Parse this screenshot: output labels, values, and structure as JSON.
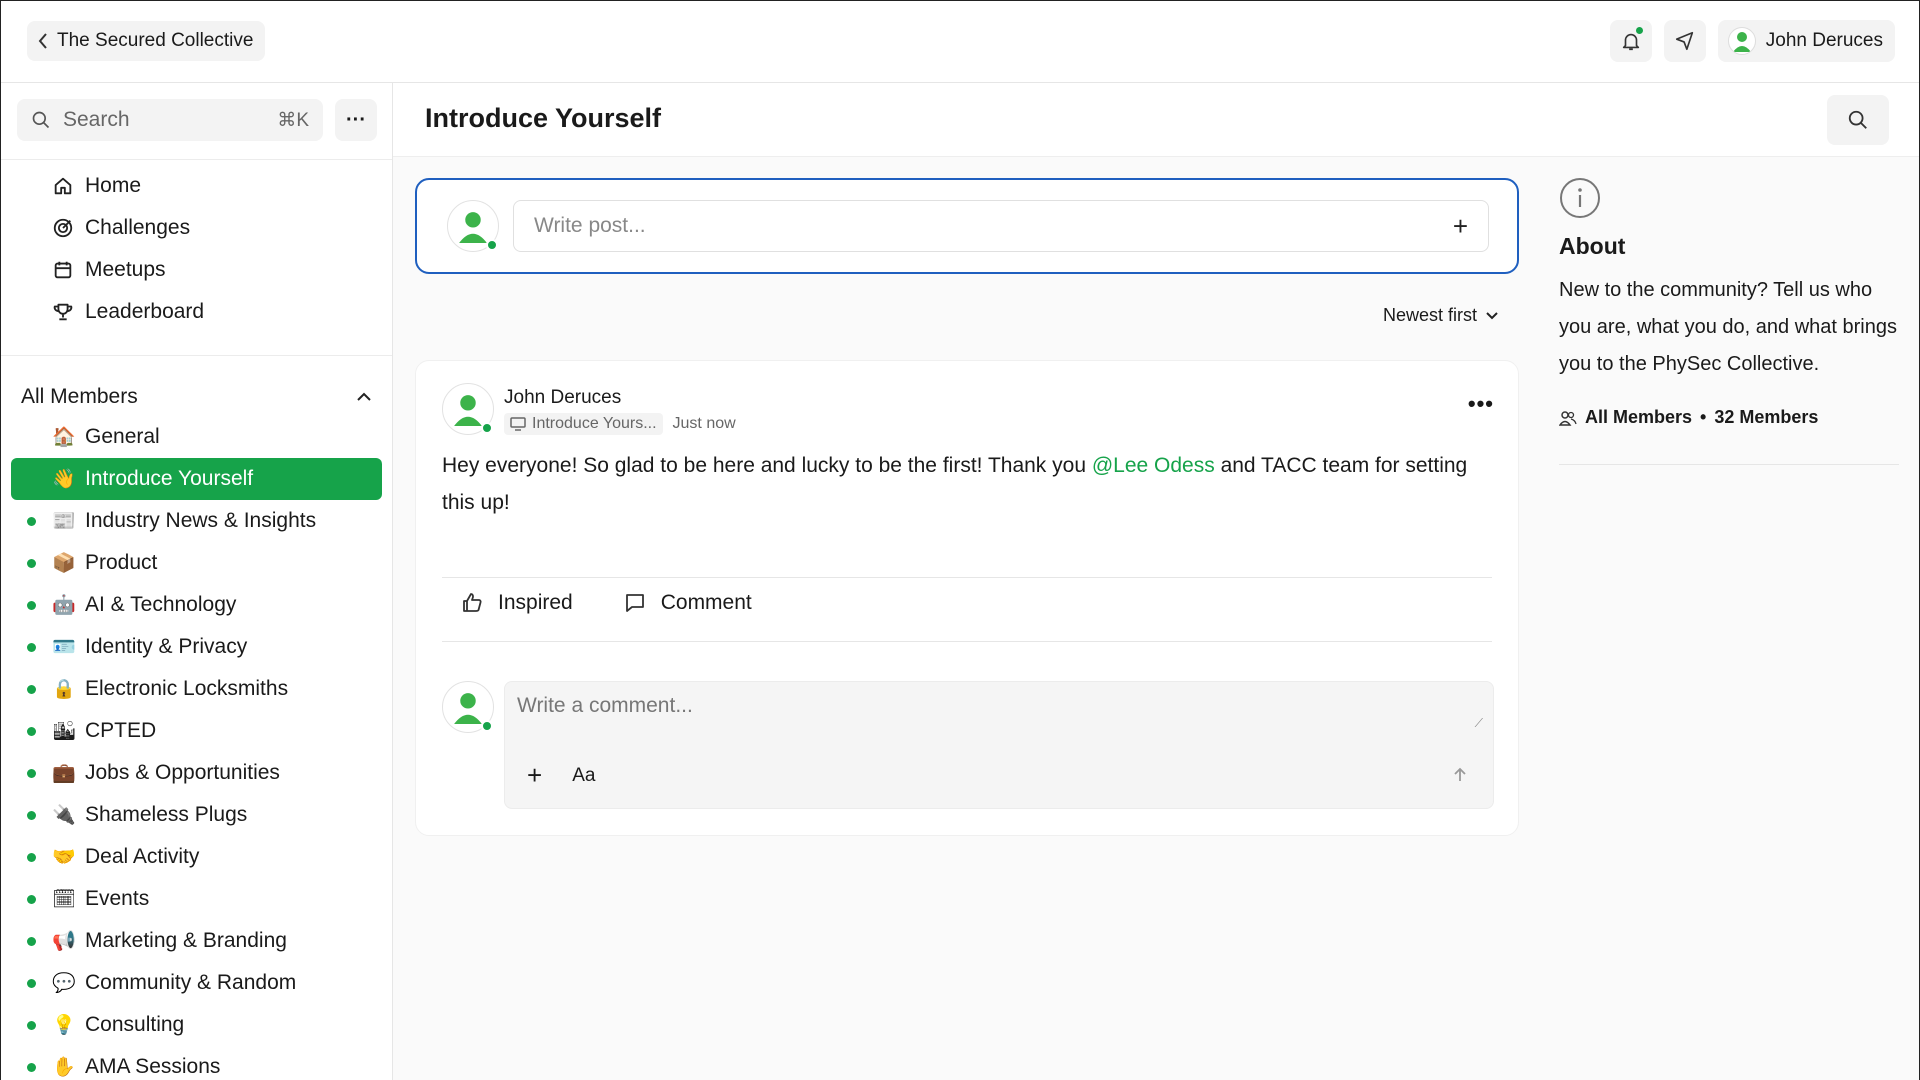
{
  "topbar": {
    "back_label": "The Secured Collective",
    "user_name": "John Deruces"
  },
  "sidebar": {
    "search_placeholder": "Search",
    "search_shortcut": "⌘K",
    "more_label": "···",
    "nav": [
      {
        "label": "Home",
        "icon": "home-icon"
      },
      {
        "label": "Challenges",
        "icon": "target-icon"
      },
      {
        "label": "Meetups",
        "icon": "calendar-icon"
      },
      {
        "label": "Leaderboard",
        "icon": "trophy-icon"
      }
    ],
    "group_label": "All Members",
    "channels": [
      {
        "emoji": "🏠",
        "label": "General",
        "dot": false,
        "active": false
      },
      {
        "emoji": "👋",
        "label": "Introduce Yourself",
        "dot": false,
        "active": true
      },
      {
        "emoji": "📰",
        "label": "Industry News & Insights",
        "dot": true,
        "active": false
      },
      {
        "emoji": "📦",
        "label": "Product",
        "dot": true,
        "active": false
      },
      {
        "emoji": "🤖",
        "label": "AI & Technology",
        "dot": true,
        "active": false
      },
      {
        "emoji": "🪪",
        "label": "Identity & Privacy",
        "dot": true,
        "active": false
      },
      {
        "emoji": "🔒",
        "label": "Electronic Locksmiths",
        "dot": true,
        "active": false
      },
      {
        "emoji": "🏙",
        "label": "CPTED",
        "dot": true,
        "active": false
      },
      {
        "emoji": "💼",
        "label": "Jobs & Opportunities",
        "dot": true,
        "active": false
      },
      {
        "emoji": "🔌",
        "label": "Shameless Plugs",
        "dot": true,
        "active": false
      },
      {
        "emoji": "🤝",
        "label": "Deal Activity",
        "dot": true,
        "active": false
      },
      {
        "emoji": "🗓",
        "label": "Events",
        "dot": true,
        "active": false
      },
      {
        "emoji": "📢",
        "label": "Marketing & Branding",
        "dot": true,
        "active": false
      },
      {
        "emoji": "💬",
        "label": "Community & Random",
        "dot": true,
        "active": false
      },
      {
        "emoji": "💡",
        "label": "Consulting",
        "dot": true,
        "active": false
      },
      {
        "emoji": "✋",
        "label": "AMA Sessions",
        "dot": true,
        "active": false
      }
    ]
  },
  "main": {
    "title": "Introduce Yourself",
    "compose_placeholder": "Write post...",
    "sort_label": "Newest first",
    "post": {
      "author": "John Deruces",
      "space_chip": "Introduce Yours...",
      "time": "Just now",
      "body_before": "Hey everyone! So glad to be here and lucky to be the first! Thank you ",
      "mention": "@Lee Odess",
      "body_after": " and TACC team for setting this up!",
      "like_label": "Inspired",
      "comment_label": "Comment",
      "comment_placeholder": "Write a comment...",
      "format_label": "Aa"
    }
  },
  "about": {
    "title": "About",
    "text": "New to the community? Tell us who you are, what you do, and what brings you to the PhySec Collective.",
    "members_label": "All Members",
    "members_count": "32 Members"
  },
  "colors": {
    "accent": "#16a34a",
    "focus_border": "#1f5fbf"
  }
}
